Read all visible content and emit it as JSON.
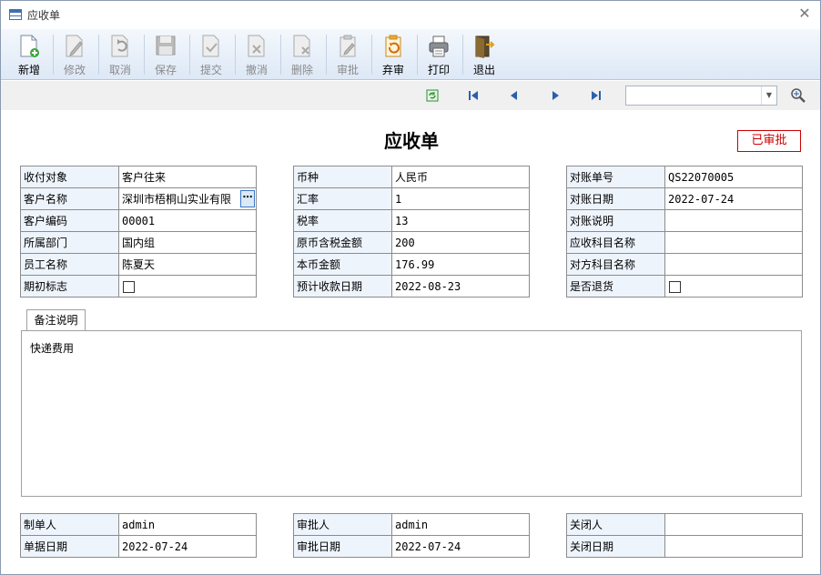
{
  "window": {
    "title": "应收单"
  },
  "toolbar": {
    "buttons": [
      {
        "label": "新增",
        "icon": "new-doc-icon",
        "enabled": true
      },
      {
        "label": "修改",
        "icon": "edit-icon",
        "enabled": false
      },
      {
        "label": "取消",
        "icon": "undo-icon",
        "enabled": false
      },
      {
        "label": "保存",
        "icon": "save-icon",
        "enabled": false
      },
      {
        "label": "提交",
        "icon": "submit-icon",
        "enabled": false
      },
      {
        "label": "撤消",
        "icon": "revoke-icon",
        "enabled": false
      },
      {
        "label": "删除",
        "icon": "delete-icon",
        "enabled": false
      },
      {
        "label": "审批",
        "icon": "approve-icon",
        "enabled": false
      },
      {
        "label": "弃审",
        "icon": "unapprove-icon",
        "enabled": true
      },
      {
        "label": "打印",
        "icon": "print-icon",
        "enabled": true
      },
      {
        "label": "退出",
        "icon": "exit-door-icon",
        "enabled": true
      }
    ]
  },
  "nav": {
    "icons": [
      "refresh-icon",
      "first-record-icon",
      "prev-record-icon",
      "next-record-icon",
      "last-record-icon"
    ],
    "search_value": ""
  },
  "document": {
    "title": "应收单",
    "status": "已审批",
    "status_color": "#cc0000"
  },
  "left_fields": {
    "rows": [
      {
        "label": "收付对象",
        "value": "客户往来"
      },
      {
        "label": "客户名称",
        "value": "深圳市梧桐山实业有限"
      },
      {
        "label": "客户编码",
        "value": "00001"
      },
      {
        "label": "所属部门",
        "value": "国内组"
      },
      {
        "label": "员工名称",
        "value": "陈夏天"
      },
      {
        "label": "期初标志",
        "value": ""
      }
    ]
  },
  "middle_fields": {
    "rows": [
      {
        "label": "币种",
        "value": "人民币"
      },
      {
        "label": "汇率",
        "value": "1"
      },
      {
        "label": "税率",
        "value": "13"
      },
      {
        "label": "原币含税金额",
        "value": "200"
      },
      {
        "label": "本币金额",
        "value": "176.99"
      },
      {
        "label": "预计收款日期",
        "value": "2022-08-23"
      }
    ]
  },
  "right_fields": {
    "rows": [
      {
        "label": "对账单号",
        "value": "QS22070005"
      },
      {
        "label": "对账日期",
        "value": "2022-07-24"
      },
      {
        "label": "对账说明",
        "value": ""
      },
      {
        "label": "应收科目名称",
        "value": ""
      },
      {
        "label": "对方科目名称",
        "value": ""
      },
      {
        "label": "是否退货",
        "value": ""
      }
    ]
  },
  "remark": {
    "tab_label": "备注说明",
    "text": "快递费用"
  },
  "footer": {
    "left": [
      {
        "label": "制单人",
        "value": "admin"
      },
      {
        "label": "单据日期",
        "value": "2022-07-24"
      }
    ],
    "middle": [
      {
        "label": "审批人",
        "value": "admin"
      },
      {
        "label": "审批日期",
        "value": "2022-07-24"
      }
    ],
    "right": [
      {
        "label": "关闭人",
        "value": ""
      },
      {
        "label": "关闭日期",
        "value": ""
      }
    ]
  }
}
